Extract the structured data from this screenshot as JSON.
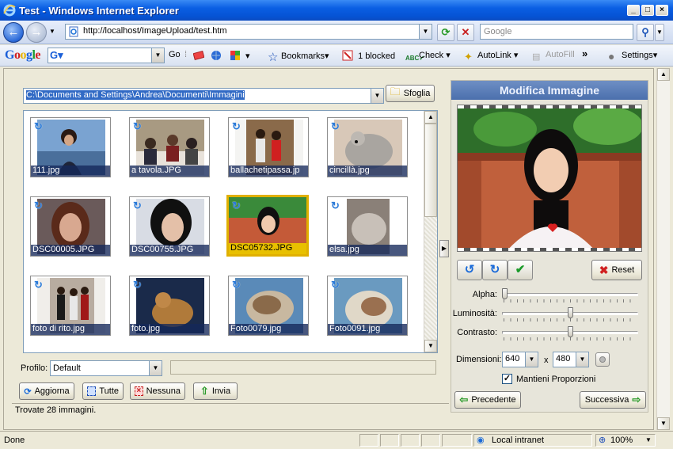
{
  "window": {
    "title": "Test - Windows Internet Explorer"
  },
  "addressbar": {
    "url": "http://localhost/ImageUpload/test.htm",
    "search_placeholder": "Google"
  },
  "google_toolbar": {
    "logo": "Google",
    "go_label": "Go",
    "bookmarks_label": "Bookmarks",
    "blocked_label": "1 blocked",
    "check_label": "Check",
    "autolink_label": "AutoLink",
    "autofill_label": "AutoFill",
    "more_label": "»",
    "settings_label": "Settings"
  },
  "uploader": {
    "path": "C:\\Documents and Settings\\Andrea\\Documenti\\Immagini",
    "browse_label": "Sfoglia",
    "thumbnails": [
      {
        "name": "111.jpg",
        "selected": false
      },
      {
        "name": "a tavola.JPG",
        "selected": false
      },
      {
        "name": "ballachetipassa.jp",
        "selected": false
      },
      {
        "name": "cincillà.jpg",
        "selected": false
      },
      {
        "name": "DSC00005.JPG",
        "selected": false
      },
      {
        "name": "DSC00755.JPG",
        "selected": false
      },
      {
        "name": "DSC05732.JPG",
        "selected": true
      },
      {
        "name": "elsa.jpg",
        "selected": false
      },
      {
        "name": "foto di rito.jpg",
        "selected": false
      },
      {
        "name": "foto.jpg",
        "selected": false
      },
      {
        "name": "Foto0079.jpg",
        "selected": false
      },
      {
        "name": "Foto0091.jpg",
        "selected": false
      }
    ],
    "profile_label": "Profilo:",
    "profile_value": "Default",
    "buttons": {
      "refresh": "Aggiorna",
      "all": "Tutte",
      "none": "Nessuna",
      "send": "Invia"
    },
    "status": "Trovate 28 immagini."
  },
  "editor": {
    "title": "Modifica Immagine",
    "reset_label": "Reset",
    "sliders": [
      {
        "label": "Alpha:",
        "value": 0.0
      },
      {
        "label": "Luminosità:",
        "value": 0.5
      },
      {
        "label": "Contrasto:",
        "value": 0.5
      }
    ],
    "dimensions_label": "Dimensioni:",
    "width": "640",
    "x_label": "x",
    "height": "480",
    "keep_proportions_label": "Mantieni Proporzioni",
    "keep_proportions_checked": true,
    "prev_label": "Precedente",
    "next_label": "Successiva"
  },
  "statusbar": {
    "text": "Done",
    "zone": "Local intranet",
    "zoom": "100%"
  },
  "colors": {
    "titlebar": "#0553d4",
    "panel_header": "#4b6fad",
    "selection": "#e0b000",
    "caption_bg": "#14285a"
  }
}
